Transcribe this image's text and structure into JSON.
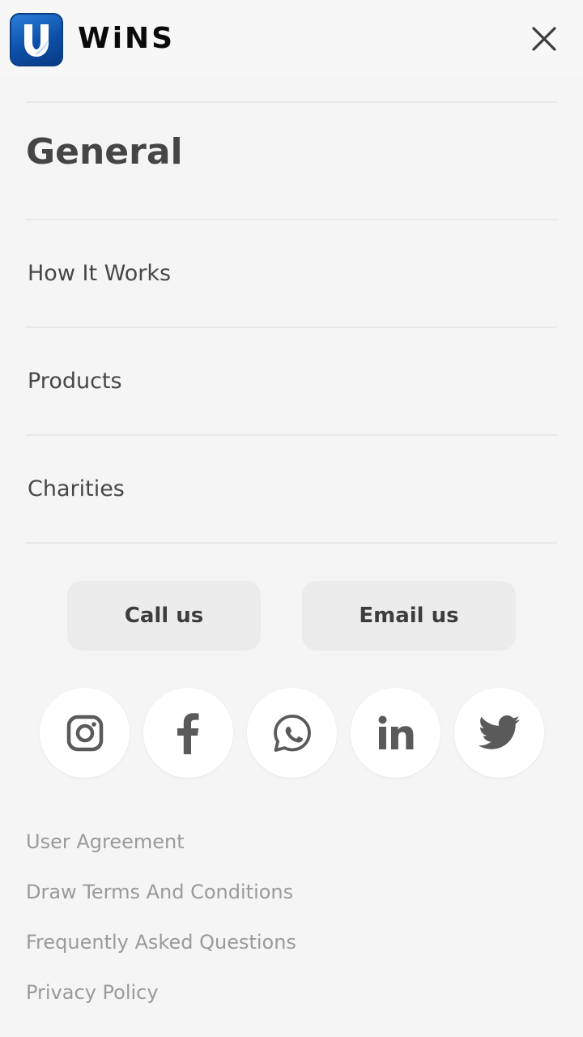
{
  "header": {
    "logo_text": "WiNS",
    "logo_letter": "U"
  },
  "menu": {
    "section_title": "General",
    "items": [
      {
        "label": "How It Works"
      },
      {
        "label": "Products"
      },
      {
        "label": "Charities"
      }
    ]
  },
  "contact": {
    "call_label": "Call us",
    "email_label": "Email us"
  },
  "social": [
    "instagram-icon",
    "facebook-icon",
    "whatsapp-icon",
    "linkedin-icon",
    "twitter-icon"
  ],
  "footer": {
    "links": [
      {
        "label": "User Agreement"
      },
      {
        "label": "Draw Terms And Conditions"
      },
      {
        "label": "Frequently Asked Questions"
      },
      {
        "label": "Privacy Policy"
      }
    ]
  },
  "colors": {
    "background": "#f5f5f5",
    "brand_blue": "#1565c0",
    "icon_gray": "#5a5a5a",
    "link_gray": "#9a9a9a"
  }
}
